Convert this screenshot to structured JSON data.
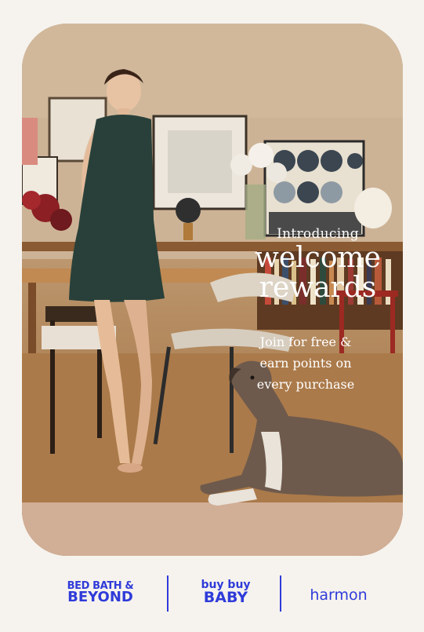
{
  "promo": {
    "intro": "Introducing",
    "headline_line1": "welcome",
    "headline_line2": "rewards",
    "body_line1": "Join for free &",
    "body_line2": "earn points on",
    "body_line3": "every purchase"
  },
  "brands": {
    "bbb_line1": "BED BATH &",
    "bbb_line2": "BEYOND",
    "bbby_line1": "buy buy",
    "bbby_line2": "BABY",
    "harmon": "harmon"
  },
  "colors": {
    "background": "#f6f3ee",
    "brand_blue": "#2f3bd9",
    "headline": "#ffffff"
  }
}
